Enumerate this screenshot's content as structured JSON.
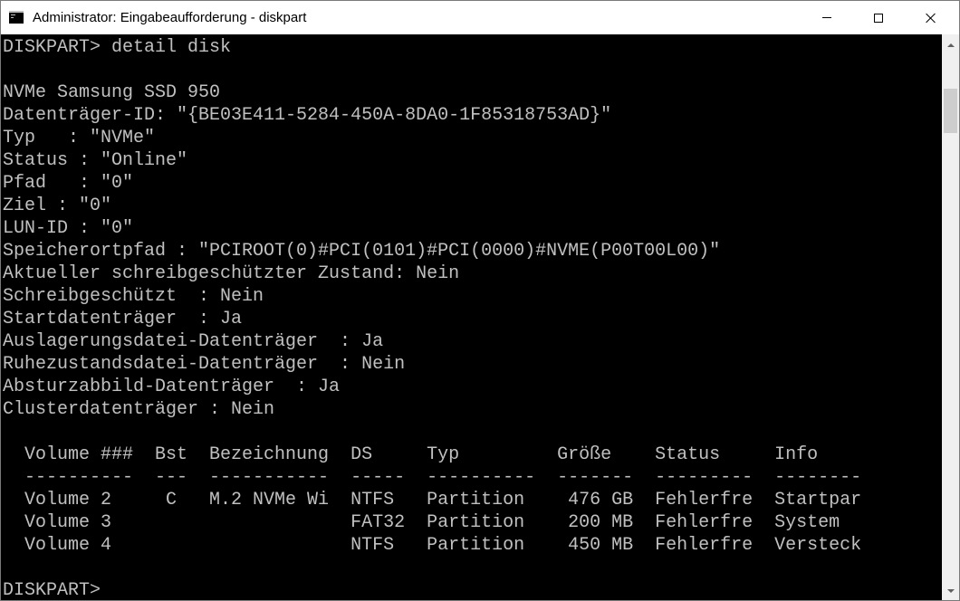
{
  "window": {
    "title": "Administrator: Eingabeaufforderung - diskpart",
    "icon": "cmd-icon"
  },
  "controls": {
    "minimize": "minimize-icon",
    "maximize": "maximize-icon",
    "close": "close-icon"
  },
  "console": {
    "lines": [
      "DISKPART> detail disk",
      "",
      "NVMe Samsung SSD 950",
      "Datenträger-ID: \"{BE03E411-5284-450A-8DA0-1F85318753AD}\"",
      "Typ   : \"NVMe\"",
      "Status : \"Online\"",
      "Pfad   : \"0\"",
      "Ziel : \"0\"",
      "LUN-ID : \"0\"",
      "Speicherortpfad : \"PCIROOT(0)#PCI(0101)#PCI(0000)#NVME(P00T00L00)\"",
      "Aktueller schreibgeschützter Zustand: Nein",
      "Schreibgeschützt  : Nein",
      "Startdatenträger  : Ja",
      "Auslagerungsdatei-Datenträger  : Ja",
      "Ruhezustandsdatei-Datenträger  : Nein",
      "Absturzabbild-Datenträger  : Ja",
      "Clusterdatenträger : Nein",
      "",
      "  Volume ###  Bst  Bezeichnung  DS     Typ         Größe    Status     Info",
      "  ----------  ---  -----------  -----  ----------  -------  ---------  --------",
      "  Volume 2     C   M.2 NVMe Wi  NTFS   Partition    476 GB  Fehlerfre  Startpar",
      "  Volume 3                      FAT32  Partition    200 MB  Fehlerfre  System",
      "  Volume 4                      NTFS   Partition    450 MB  Fehlerfre  Versteck",
      "",
      "DISKPART>"
    ]
  },
  "colors": {
    "console_bg": "#000000",
    "console_fg": "#c0c0c0",
    "titlebar_bg": "#ffffff"
  }
}
